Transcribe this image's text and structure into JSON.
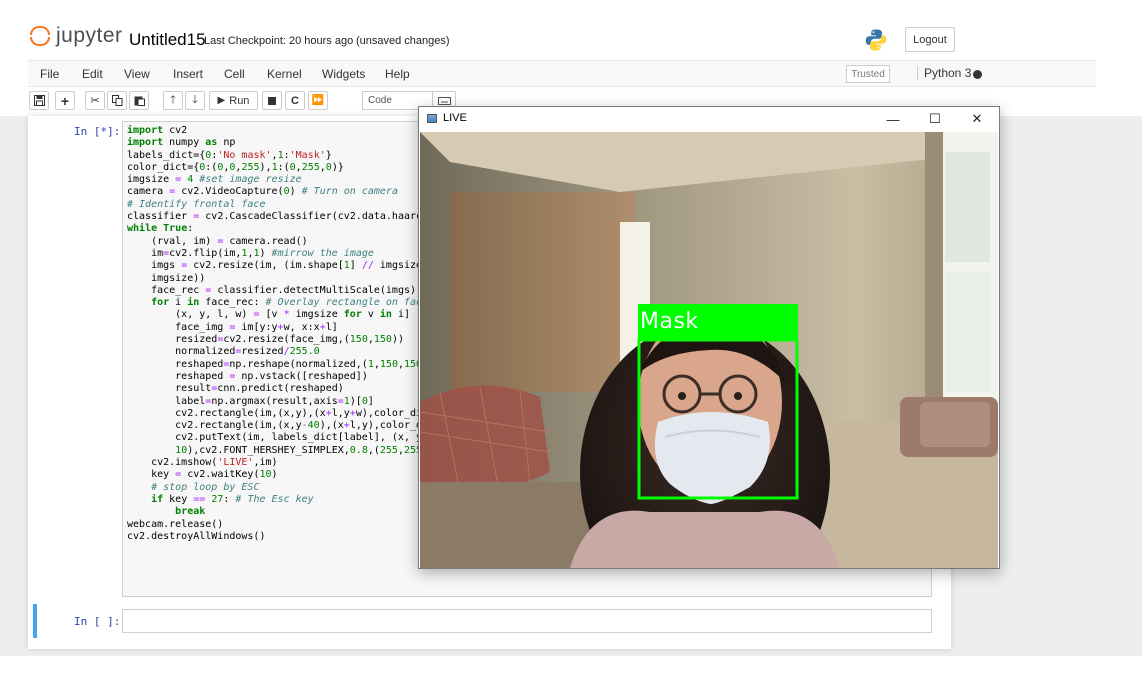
{
  "header": {
    "logo_text": "jupyter",
    "notebook_title": "Untitled15",
    "checkpoint": "Last Checkpoint: 20 hours ago",
    "unsaved": "(unsaved changes)",
    "logout_label": "Logout"
  },
  "menubar": {
    "items": [
      "File",
      "Edit",
      "View",
      "Insert",
      "Cell",
      "Kernel",
      "Widgets",
      "Help"
    ],
    "trusted": "Trusted",
    "kernel": "Python 3"
  },
  "toolbar": {
    "run_label": "Run",
    "cell_type": "Code"
  },
  "cells": {
    "cell1_prompt": "In [*]:",
    "cell2_prompt": "In [ ]:"
  },
  "live_window": {
    "title": "LIVE",
    "minimize": "—",
    "maximize": "☐",
    "close": "✕",
    "overlay_label": "Mask"
  },
  "colors": {
    "accent_orange": "#f37726",
    "selected_cell": "#42a5f5",
    "overlay_green": "#00ff00"
  }
}
